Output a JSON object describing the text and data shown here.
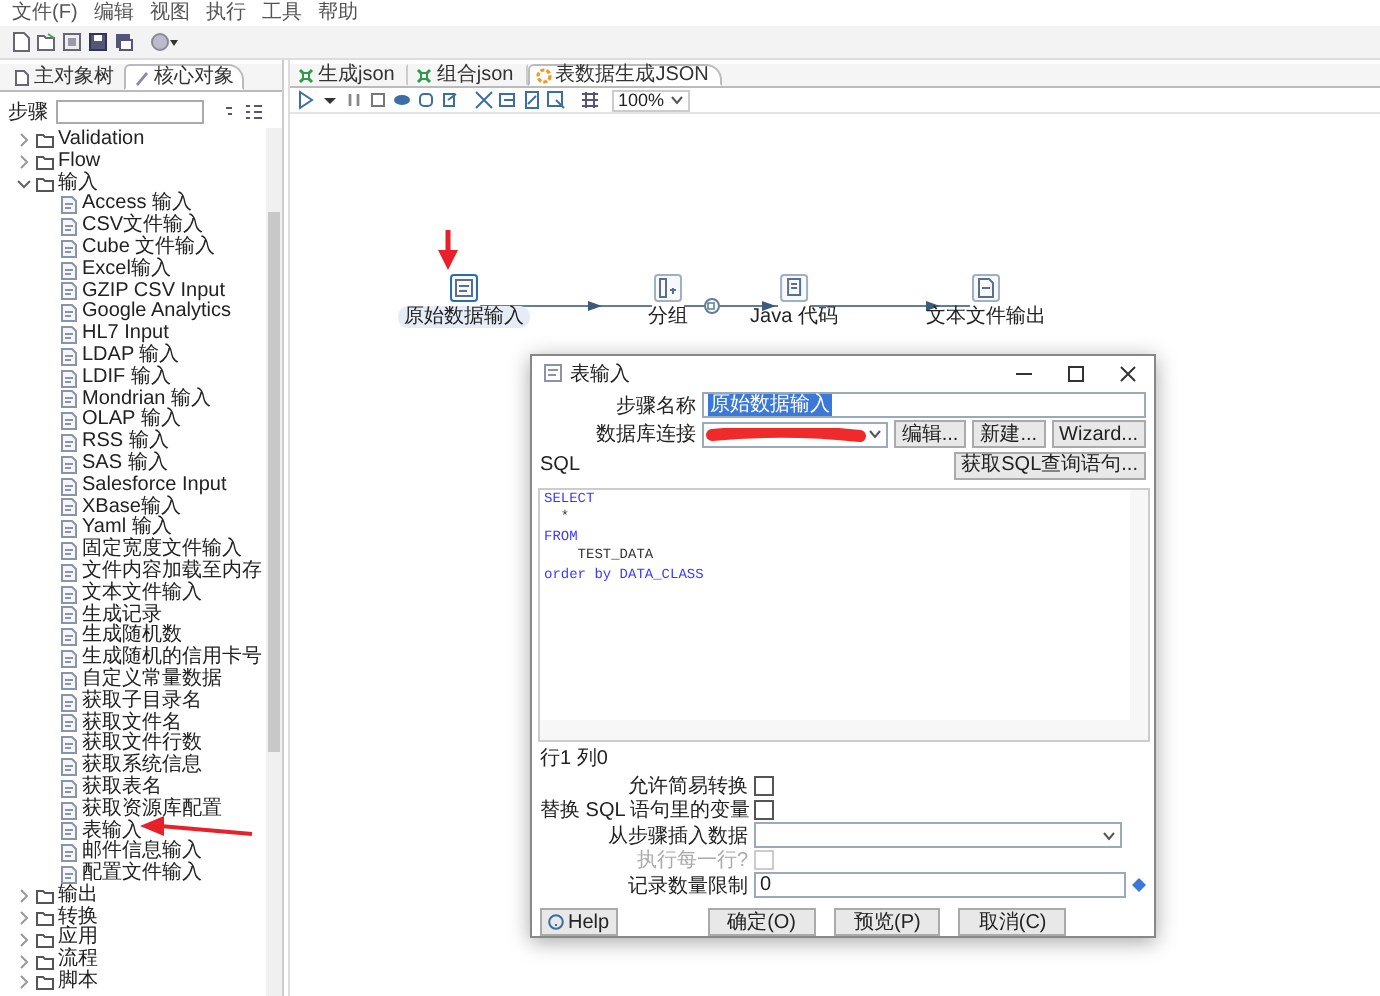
{
  "menu": [
    "文件(F)",
    "编辑",
    "视图",
    "执行",
    "工具",
    "帮助"
  ],
  "left_tabs": [
    {
      "label": "主对象树",
      "selected": false
    },
    {
      "label": "核心对象",
      "selected": true
    }
  ],
  "steps_search": {
    "label": "步骤"
  },
  "tree": [
    {
      "label": "Validation",
      "expanded": false
    },
    {
      "label": "Flow",
      "expanded": false
    },
    {
      "label": "输入",
      "expanded": true,
      "children": [
        {
          "label": "Access 输入"
        },
        {
          "label": "CSV文件输入"
        },
        {
          "label": "Cube 文件输入"
        },
        {
          "label": "Excel输入"
        },
        {
          "label": "GZIP CSV Input"
        },
        {
          "label": "Google Analytics"
        },
        {
          "label": "HL7 Input"
        },
        {
          "label": "LDAP 输入"
        },
        {
          "label": "LDIF 输入"
        },
        {
          "label": "Mondrian 输入"
        },
        {
          "label": "OLAP 输入"
        },
        {
          "label": "RSS 输入"
        },
        {
          "label": "SAS 输入"
        },
        {
          "label": "Salesforce Input"
        },
        {
          "label": "XBase输入"
        },
        {
          "label": "Yaml 输入"
        },
        {
          "label": "固定宽度文件输入"
        },
        {
          "label": "文件内容加载至内存"
        },
        {
          "label": "文本文件输入"
        },
        {
          "label": "生成记录"
        },
        {
          "label": "生成随机数"
        },
        {
          "label": "生成随机的信用卡号"
        },
        {
          "label": "自定义常量数据"
        },
        {
          "label": "获取子目录名"
        },
        {
          "label": "获取文件名"
        },
        {
          "label": "获取文件行数"
        },
        {
          "label": "获取系统信息"
        },
        {
          "label": "获取表名"
        },
        {
          "label": "获取资源库配置"
        },
        {
          "label": "表输入"
        },
        {
          "label": "邮件信息输入"
        },
        {
          "label": "配置文件输入"
        }
      ]
    },
    {
      "label": "输出",
      "expanded": false
    },
    {
      "label": "转换",
      "expanded": false
    },
    {
      "label": "应用",
      "expanded": false
    },
    {
      "label": "流程",
      "expanded": false
    },
    {
      "label": "脚本",
      "expanded": false
    }
  ],
  "editor_tabs": [
    {
      "label": "生成json",
      "selected": false
    },
    {
      "label": "组合json",
      "selected": false
    },
    {
      "label": "表数据生成JSON",
      "selected": true
    }
  ],
  "zoom": {
    "value": "100%"
  },
  "canvas_steps": [
    {
      "label": "原始数据输入",
      "selected": true
    },
    {
      "label": "分组",
      "selected": false
    },
    {
      "label": "Java 代码",
      "selected": false
    },
    {
      "label": "文本文件输出",
      "selected": false
    }
  ],
  "dialog": {
    "title": "表输入",
    "step_name": {
      "label": "步骤名称",
      "value": "原始数据输入",
      "text_selected": true
    },
    "connection": {
      "label": "数据库连接",
      "redacted": true,
      "buttons": [
        "编辑...",
        "新建...",
        "Wizard..."
      ]
    },
    "sql_label": "SQL",
    "get_sql_button": "获取SQL查询语句...",
    "sql_lines": [
      {
        "kind": "keyword",
        "text": "SELECT"
      },
      {
        "kind": "plain",
        "text": "  *"
      },
      {
        "kind": "keyword",
        "text": "FROM"
      },
      {
        "kind": "plain",
        "text": "    TEST_DATA"
      },
      {
        "kind": "keyword",
        "text": "order by DATA_CLASS"
      }
    ],
    "cursor": "行1 列0",
    "options": [
      {
        "kind": "checkbox",
        "label": "允许简易转换",
        "checked": false,
        "disabled": false
      },
      {
        "kind": "checkbox",
        "label": "替换 SQL 语句里的变量",
        "checked": false,
        "disabled": false
      },
      {
        "kind": "combo",
        "label": "从步骤插入数据"
      },
      {
        "kind": "checkbox",
        "label": "执行每一行?",
        "checked": false,
        "disabled": true
      },
      {
        "kind": "input",
        "label": "记录数量限制",
        "value": "0"
      }
    ],
    "help": "Help",
    "buttons": [
      "确定(O)",
      "预览(P)",
      "取消(C)"
    ]
  }
}
